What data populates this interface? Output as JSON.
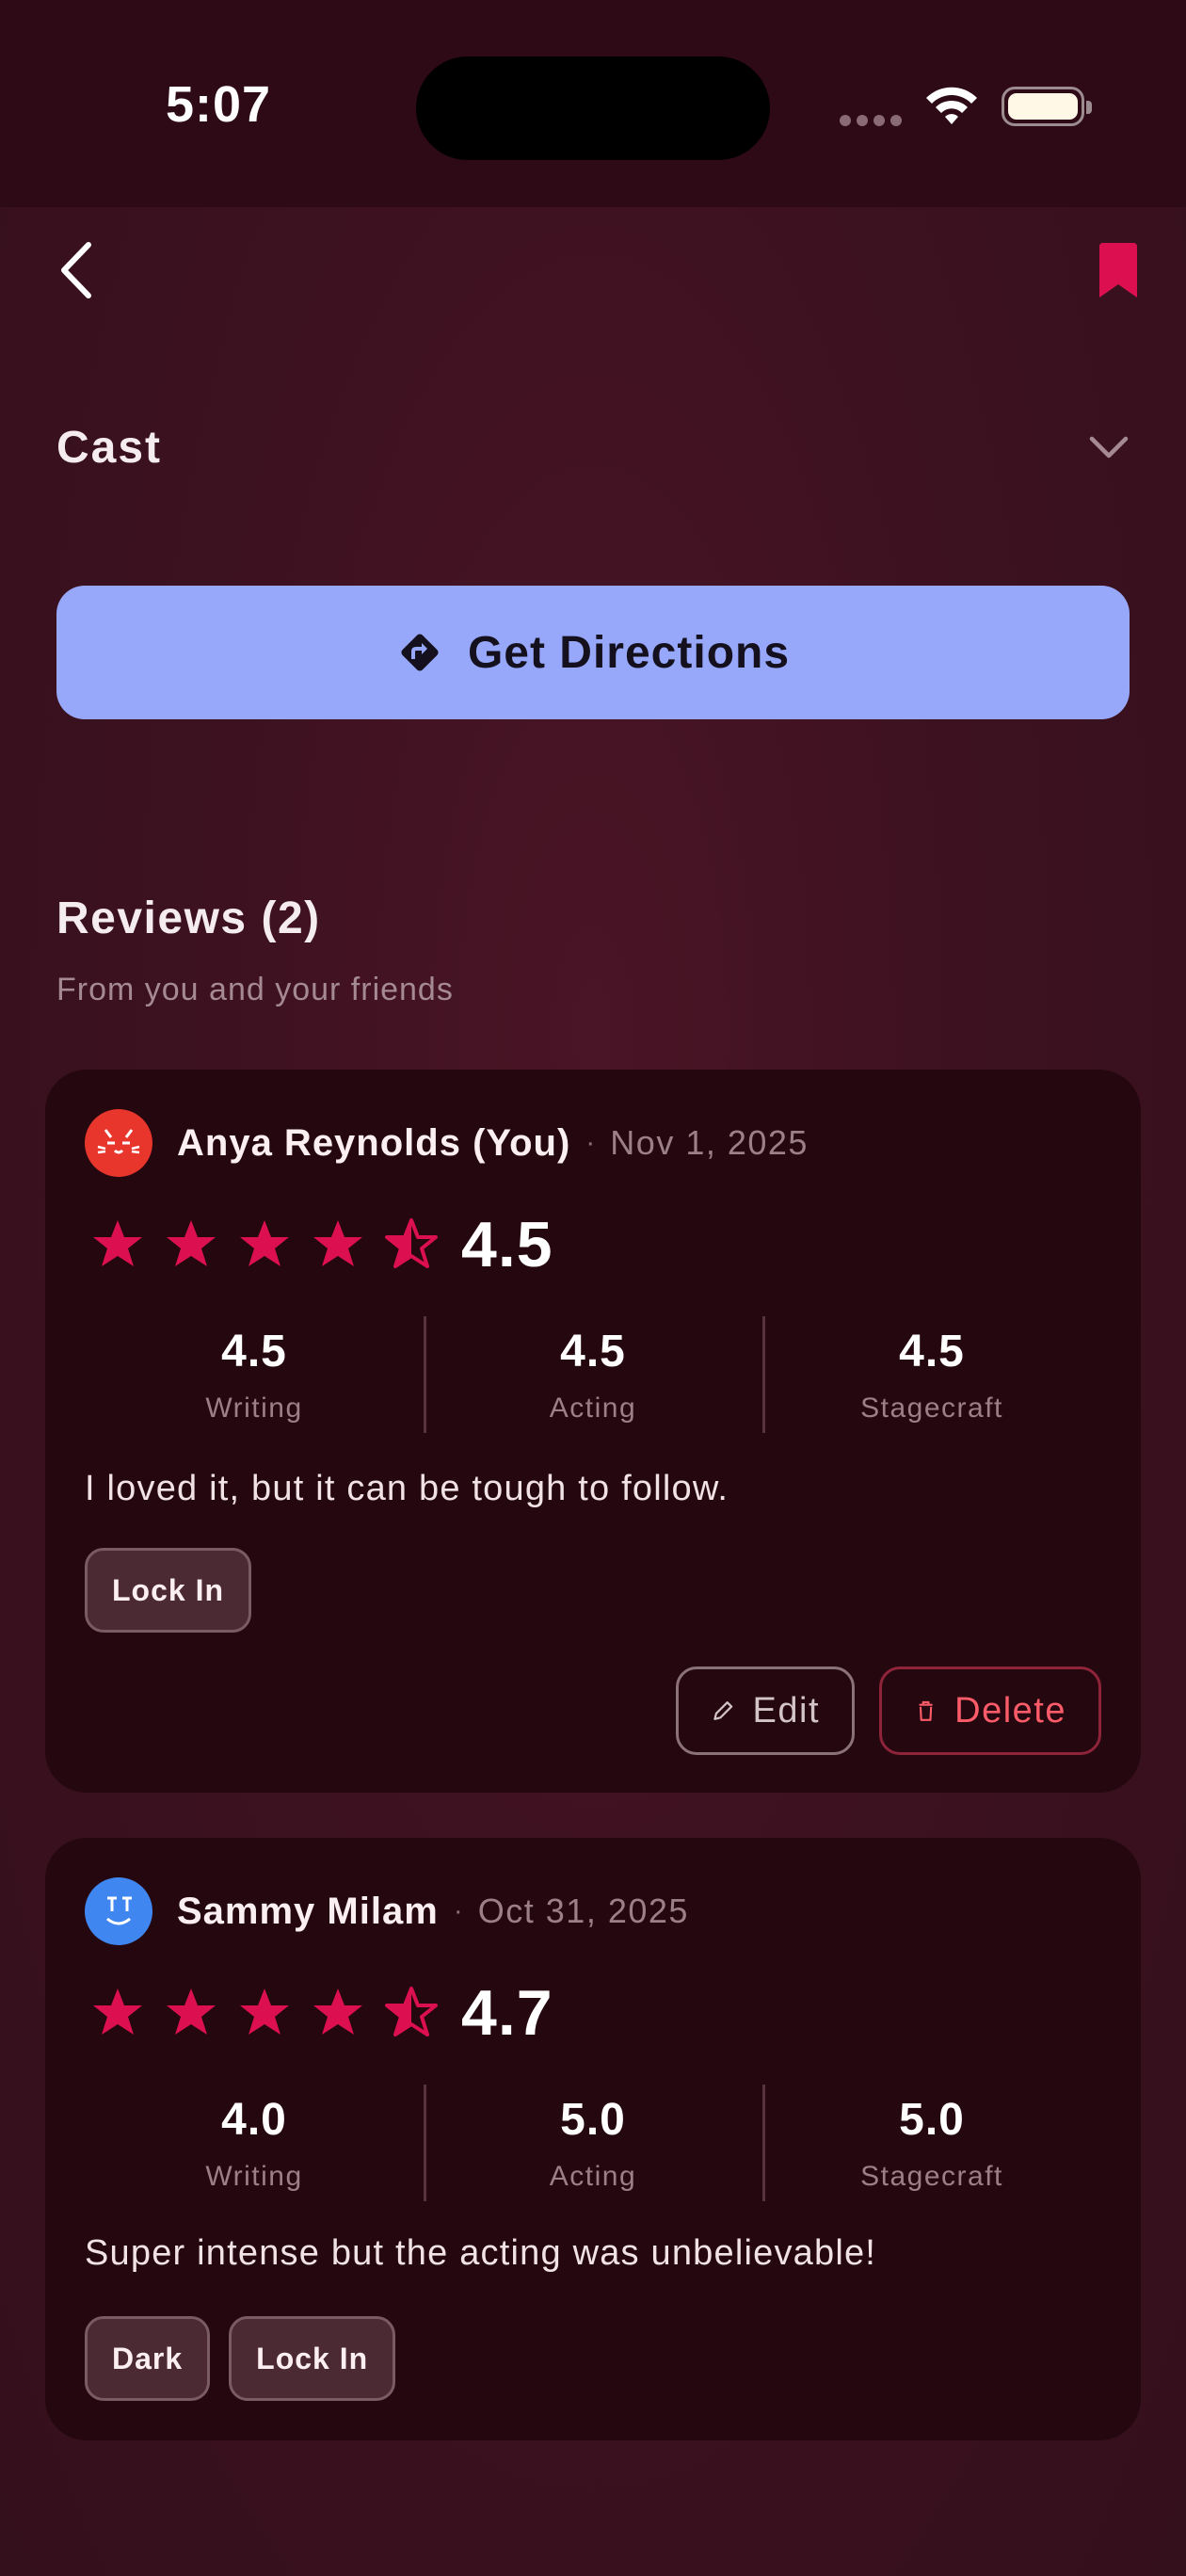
{
  "status_bar": {
    "time": "5:07"
  },
  "colors": {
    "accent": "#dc1050",
    "button": "#97a8fb",
    "card": "#25070f",
    "background": "#3d1120"
  },
  "nav": {
    "back_icon": "chevron-left-icon",
    "bookmark_icon": "bookmark-icon"
  },
  "cast": {
    "title": "Cast",
    "expand_icon": "chevron-down-icon"
  },
  "directions": {
    "label": "Get Directions",
    "icon": "directions-icon"
  },
  "reviews": {
    "title": "Reviews (2)",
    "subtitle": "From you and your friends",
    "items": [
      {
        "name": "Anya Reynolds (You)",
        "separator": "·",
        "date": "Nov 1, 2025",
        "rating": "4.5",
        "stars_value": 4.5,
        "scores": [
          {
            "value": "4.5",
            "label": "Writing"
          },
          {
            "value": "4.5",
            "label": "Acting"
          },
          {
            "value": "4.5",
            "label": "Stagecraft"
          }
        ],
        "text": "I loved it, but it can be tough to follow.",
        "tags": [
          "Lock In"
        ],
        "edit_label": "Edit",
        "delete_label": "Delete"
      },
      {
        "name": "Sammy Milam",
        "separator": "·",
        "date": "Oct 31, 2025",
        "rating": "4.7",
        "stars_value": 4.5,
        "scores": [
          {
            "value": "4.0",
            "label": "Writing"
          },
          {
            "value": "5.0",
            "label": "Acting"
          },
          {
            "value": "5.0",
            "label": "Stagecraft"
          }
        ],
        "text": "Super intense but the acting was unbelievable!",
        "tags": [
          "Dark",
          "Lock In"
        ]
      }
    ]
  }
}
